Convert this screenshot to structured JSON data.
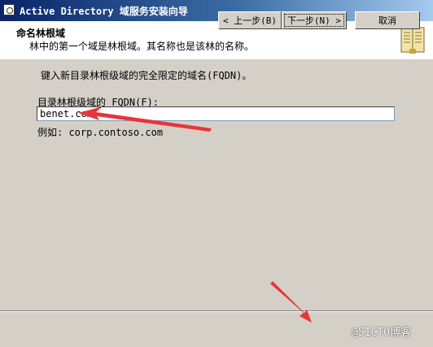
{
  "window": {
    "title": "Active Directory 域服务安装向导"
  },
  "header": {
    "title": "命名林根域",
    "subtitle": "林中的第一个域是林根域。其名称也是该林的名称。",
    "icon": "book-icon"
  },
  "main": {
    "instruction": "键入新目录林根级域的完全限定的域名(FQDN)。",
    "field_label": "目录林根级域的 FQDN(F):",
    "domain_value": "benet.com",
    "example": "例如: corp.contoso.com"
  },
  "buttons": {
    "back": "< 上一步(B)",
    "next": "下一步(N) >",
    "cancel": "取消"
  },
  "watermark": "@51CTO博客",
  "colors": {
    "annotation_arrow": "#e8343c",
    "title_bar_start": "#0a246a",
    "title_bar_end": "#a6caf0"
  }
}
